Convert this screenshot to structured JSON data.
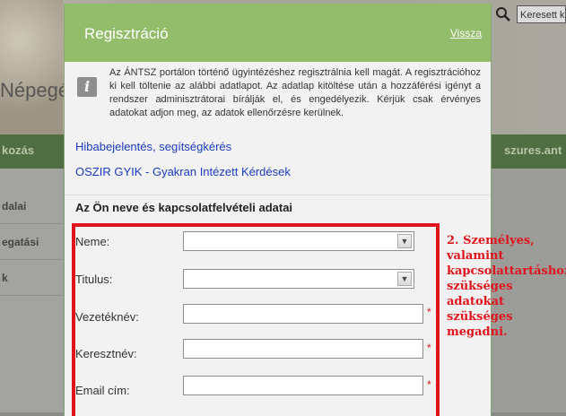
{
  "background": {
    "site_title_fragment": "Népegé",
    "search_value": "Keresett kif",
    "nav_left": "kozás",
    "nav_right": "szures.ant",
    "side_items": [
      "dalai",
      "egatási",
      "k"
    ]
  },
  "modal": {
    "title": "Regisztráció",
    "back_link": "Vissza",
    "info_text": "Az ÁNTSZ portálon történő ügyintézéshez regisztrálnia kell magát. A regisztrációhoz ki kell töltenie az alábbi adatlapot. Az adatlap kitöltése után a hozzáférési igényt a rendszer adminisztrátorai bírálják el, és engedélyezik. Kérjük csak érvényes adatokat adjon meg, az adatok ellenőrzésre kerülnek.",
    "links": [
      "Hibabejelentés, segítségkérés",
      "OSZIR GYIK - Gyakran Intézett Kérdések"
    ],
    "section_title": "Az Ön neve és kapcsolatfelvételi adatai",
    "fields": {
      "gender": {
        "label": "Neme:",
        "value": ""
      },
      "title": {
        "label": "Titulus:",
        "value": ""
      },
      "last_name": {
        "label": "Vezetéknév:",
        "value": "",
        "required_mark": "*"
      },
      "first_name": {
        "label": "Keresztnév:",
        "value": "",
        "required_mark": "*"
      },
      "email": {
        "label": "Email cím:",
        "value": "",
        "required_mark": "*"
      }
    }
  },
  "annotation": "2. Személyes, valamint kapcsolattartáshoz szükséges adatokat szükséges megadni.",
  "colors": {
    "accent": "#94bd6b",
    "highlight": "#e0141c",
    "link": "#1a3bc1"
  }
}
